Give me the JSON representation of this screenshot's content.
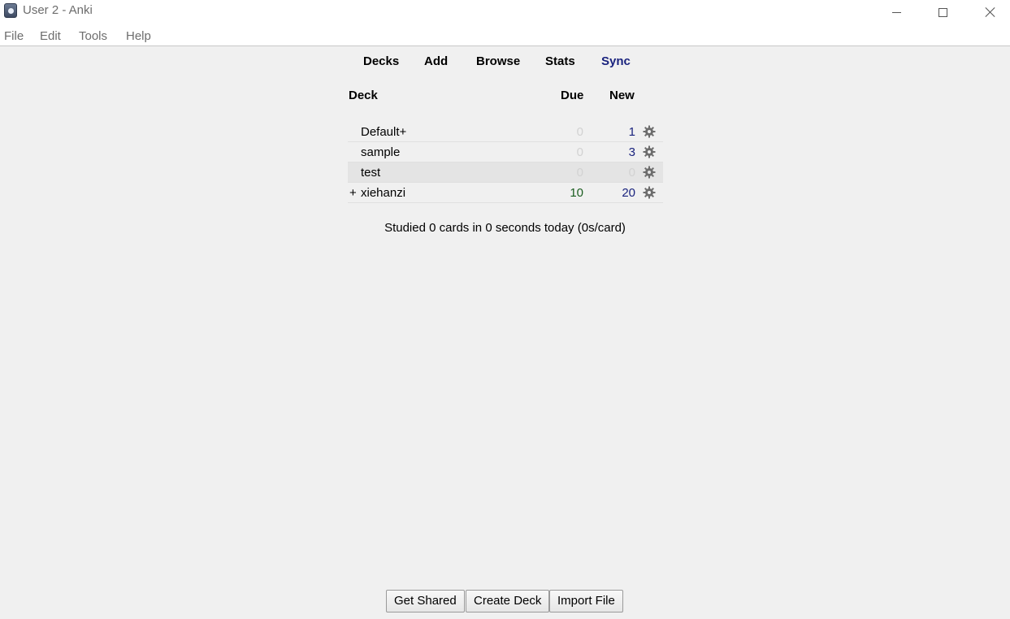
{
  "window": {
    "title": "User 2 - Anki"
  },
  "menu": [
    "File",
    "Edit",
    "Tools",
    "Help"
  ],
  "toolbar": {
    "decks": "Decks",
    "add": "Add",
    "browse": "Browse",
    "stats": "Stats",
    "sync": "Sync"
  },
  "table": {
    "headers": {
      "deck": "Deck",
      "due": "Due",
      "new": "New"
    },
    "rows": [
      {
        "collapse": "",
        "name": "Default+",
        "due": "0",
        "new": "1"
      },
      {
        "collapse": "",
        "name": "sample",
        "due": "0",
        "new": "3"
      },
      {
        "collapse": "",
        "name": "test",
        "due": "0",
        "new": "0"
      },
      {
        "collapse": "+",
        "name": "xiehanzi",
        "due": "10",
        "new": "20"
      }
    ]
  },
  "studied": "Studied 0 cards in 0 seconds today (0s/card)",
  "buttons": {
    "get_shared": "Get Shared",
    "create_deck": "Create Deck",
    "import_file": "Import File"
  },
  "colors": {
    "due_nonzero": "#1b5e20",
    "new_nonzero": "#1a237e",
    "zero": "#d2d2d2",
    "sync_link": "#1a237e"
  }
}
